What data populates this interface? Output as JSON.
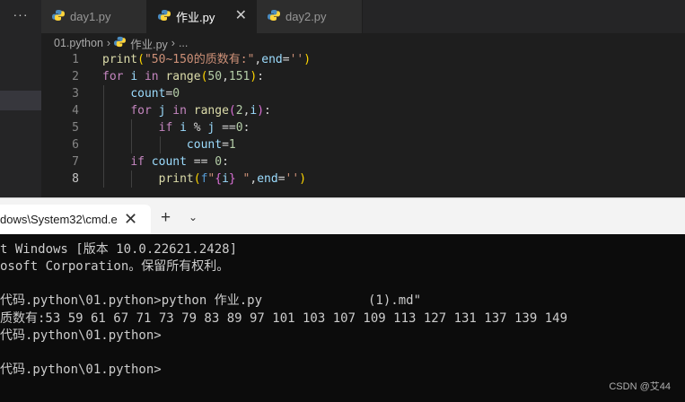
{
  "activity_bar": {
    "more_label": "···"
  },
  "tabs": [
    {
      "label": "day1.py",
      "icon": "python-icon"
    },
    {
      "label": "作业.py",
      "icon": "python-icon",
      "active": true,
      "close": "✕"
    },
    {
      "label": "day2.py",
      "icon": "python-icon"
    }
  ],
  "breadcrumb": {
    "folder": "01.python",
    "sep": "›",
    "file": "作业.py",
    "more": "..."
  },
  "editor": {
    "line_numbers": [
      "1",
      "2",
      "3",
      "4",
      "5",
      "6",
      "7",
      "8"
    ],
    "current_line": "8",
    "code": [
      [
        [
          "f",
          "print"
        ],
        [
          "b",
          "("
        ],
        [
          "s",
          "\"50~150的质数有:\""
        ],
        [
          "p",
          ","
        ],
        [
          "v",
          "end"
        ],
        [
          "p",
          "="
        ],
        [
          "s",
          "''"
        ],
        [
          "b",
          ")"
        ]
      ],
      [
        [
          "kc",
          "for"
        ],
        [
          "p",
          " "
        ],
        [
          "v",
          "i"
        ],
        [
          "p",
          " "
        ],
        [
          "kc",
          "in"
        ],
        [
          "p",
          " "
        ],
        [
          "f",
          "range"
        ],
        [
          "b",
          "("
        ],
        [
          "n",
          "50"
        ],
        [
          "p",
          ","
        ],
        [
          "n",
          "151"
        ],
        [
          "b",
          ")"
        ],
        [
          "p",
          ":"
        ]
      ],
      [
        [
          "p",
          "    "
        ],
        [
          "v",
          "count"
        ],
        [
          "p",
          "="
        ],
        [
          "n",
          "0"
        ]
      ],
      [
        [
          "p",
          "    "
        ],
        [
          "kc",
          "for"
        ],
        [
          "p",
          " "
        ],
        [
          "v",
          "j"
        ],
        [
          "p",
          " "
        ],
        [
          "kc",
          "in"
        ],
        [
          "p",
          " "
        ],
        [
          "f",
          "range"
        ],
        [
          "b2",
          "("
        ],
        [
          "n",
          "2"
        ],
        [
          "p",
          ","
        ],
        [
          "v",
          "i"
        ],
        [
          "b2",
          ")"
        ],
        [
          "p",
          ":"
        ]
      ],
      [
        [
          "p",
          "        "
        ],
        [
          "kc",
          "if"
        ],
        [
          "p",
          " "
        ],
        [
          "v",
          "i"
        ],
        [
          "p",
          " % "
        ],
        [
          "v",
          "j"
        ],
        [
          "p",
          " =="
        ],
        [
          "n",
          "0"
        ],
        [
          "p",
          ":"
        ]
      ],
      [
        [
          "p",
          "            "
        ],
        [
          "v",
          "count"
        ],
        [
          "p",
          "="
        ],
        [
          "n",
          "1"
        ]
      ],
      [
        [
          "p",
          "    "
        ],
        [
          "kc",
          "if"
        ],
        [
          "p",
          " "
        ],
        [
          "v",
          "count"
        ],
        [
          "p",
          " == "
        ],
        [
          "n",
          "0"
        ],
        [
          "p",
          ":"
        ]
      ],
      [
        [
          "p",
          "        "
        ],
        [
          "f",
          "print"
        ],
        [
          "b",
          "("
        ],
        [
          "fx",
          "f"
        ],
        [
          "s",
          "\""
        ],
        [
          "b2",
          "{"
        ],
        [
          "v",
          "i"
        ],
        [
          "b2",
          "}"
        ],
        [
          "s",
          " \""
        ],
        [
          "p",
          ","
        ],
        [
          "v",
          "end"
        ],
        [
          "p",
          "="
        ],
        [
          "s",
          "''"
        ],
        [
          "b",
          ")"
        ]
      ]
    ]
  },
  "cmd": {
    "tab_title": "dows\\System32\\cmd.e",
    "close": "✕",
    "new_tab": "+",
    "dropdown": "⌄",
    "lines": [
      "t Windows [版本 10.0.22621.2428]",
      "osoft Corporation。保留所有权利。",
      "",
      "代码.python\\01.python>python 作业.py              (1).md\"",
      "质数有:53 59 61 67 71 73 79 83 89 97 101 103 107 109 113 127 131 137 139 149",
      "代码.python\\01.python>",
      "",
      "代码.python\\01.python>"
    ]
  },
  "watermark": "CSDN @艾44",
  "colors": {
    "editor_bg": "#1e1e1e",
    "terminal_bg": "#0c0c0c",
    "python_icon_blue": "#4b8bbe",
    "python_icon_yellow": "#ffd43b"
  }
}
